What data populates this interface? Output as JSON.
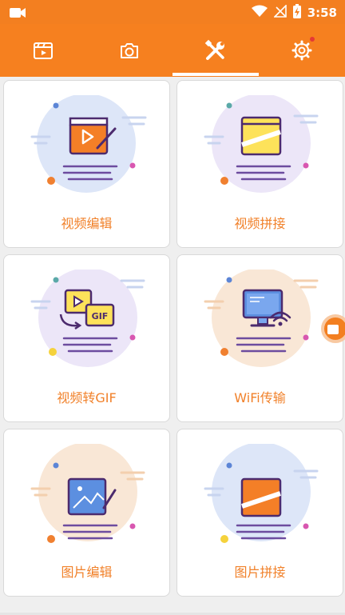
{
  "status": {
    "time": "3:58"
  },
  "tabs": [
    {
      "name": "video",
      "icon": "video-clapper-icon"
    },
    {
      "name": "camera",
      "icon": "camera-icon"
    },
    {
      "name": "tools",
      "icon": "wrench-screwdriver-icon",
      "selected": true
    },
    {
      "name": "settings",
      "icon": "gear-icon",
      "badge": true
    }
  ],
  "cards": [
    {
      "label": "视频编辑",
      "icon": "video-edit-icon"
    },
    {
      "label": "视频拼接",
      "icon": "video-join-icon"
    },
    {
      "label": "视频转GIF",
      "icon": "video-to-gif-icon"
    },
    {
      "label": "WiFi传输",
      "icon": "wifi-transfer-icon"
    },
    {
      "label": "图片编辑",
      "icon": "image-edit-icon"
    },
    {
      "label": "图片拼接",
      "icon": "image-join-icon"
    }
  ],
  "gif_text": "GIF",
  "colors": {
    "accent": "#f6801f",
    "label": "#f1812a",
    "badge": "#e53935"
  }
}
